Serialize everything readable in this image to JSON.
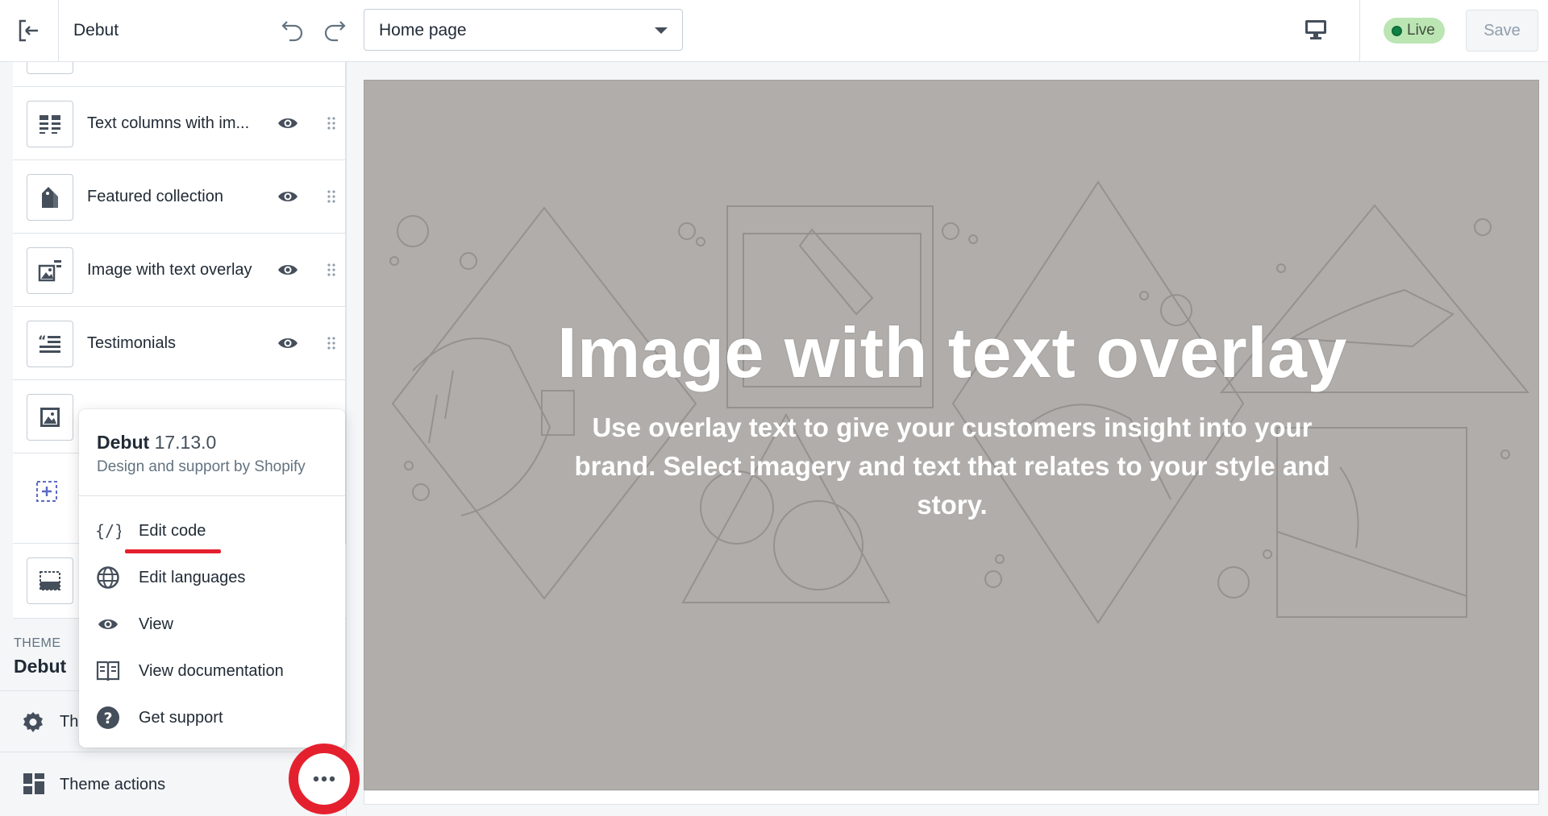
{
  "topbar": {
    "theme_title": "Debut",
    "page_select_value": "Home page",
    "live_label": "Live",
    "save_label": "Save"
  },
  "sections": [
    {
      "label": "Text columns with im...",
      "icon": "text-columns-icon"
    },
    {
      "label": "Featured collection",
      "icon": "collection-tag-icon"
    },
    {
      "label": "Image with text overlay",
      "icon": "image-text-icon"
    },
    {
      "label": "Testimonials",
      "icon": "quote-icon"
    }
  ],
  "sidebar": {
    "theme_caption": "THEME",
    "theme_name": "Debut",
    "settings_label": "Th",
    "actions_label": "Theme actions"
  },
  "popover": {
    "name": "Debut",
    "version": "17.13.0",
    "subtitle": "Design and support by Shopify",
    "items": [
      {
        "label": "Edit code",
        "icon": "code-icon"
      },
      {
        "label": "Edit languages",
        "icon": "globe-icon"
      },
      {
        "label": "View",
        "icon": "eye-icon"
      },
      {
        "label": "View documentation",
        "icon": "book-icon"
      },
      {
        "label": "Get support",
        "icon": "question-icon"
      }
    ]
  },
  "preview": {
    "title": "Image with text overlay",
    "text": "Use overlay text to give your customers insight into your brand. Select imagery and text that relates to your style and story."
  },
  "colors": {
    "highlight_red": "#e5202e",
    "preview_bg": "#b0adaa",
    "live_green": "#bbe5b3"
  }
}
